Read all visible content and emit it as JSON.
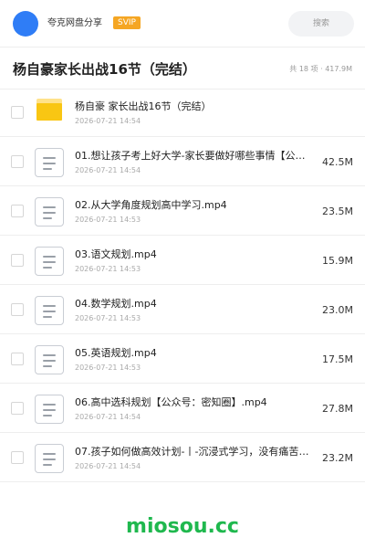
{
  "header": {
    "username": "夸克网盘分享",
    "badge": "SVIP",
    "search_label": "搜索"
  },
  "folder": {
    "title": "杨自豪家长出战16节（完结）",
    "meta": "共 18 项 · 417.9M"
  },
  "files": [
    {
      "type": "folder",
      "name": "杨自豪 家长出战16节（完结）",
      "date": "2026-07-21 14:54",
      "size": ""
    },
    {
      "type": "file",
      "name": "01.想让孩子考上好大学-家长要做好哪些事情【公众号：密知圈】.mp4",
      "date": "2026-07-21 14:54",
      "size": "42.5M"
    },
    {
      "type": "file",
      "name": "02.从大学角度规划高中学习.mp4",
      "date": "2026-07-21 14:53",
      "size": "23.5M"
    },
    {
      "type": "file",
      "name": "03.语文规划.mp4",
      "date": "2026-07-21 14:53",
      "size": "15.9M"
    },
    {
      "type": "file",
      "name": "04.数学规划.mp4",
      "date": "2026-07-21 14:53",
      "size": "23.0M"
    },
    {
      "type": "file",
      "name": "05.英语规划.mp4",
      "date": "2026-07-21 14:53",
      "size": "17.5M"
    },
    {
      "type": "file",
      "name": "06.高中选科规划【公众号：密知圈】.mp4",
      "date": "2026-07-21 14:54",
      "size": "27.8M"
    },
    {
      "type": "file",
      "name": "07.孩子如何做高效计划-丨-沉浸式学习，没有痛苦的学习.mp4",
      "date": "2026-07-21 14:54",
      "size": "23.2M"
    }
  ],
  "watermark": "miosou.cc",
  "colors": {
    "avatar": "#2f7df6",
    "badge": "#f5a623",
    "folder_icon": "#f9c613",
    "watermark": "#1fb84e"
  },
  "icons": {
    "folder": "folder-icon",
    "file": "video-file-icon"
  }
}
